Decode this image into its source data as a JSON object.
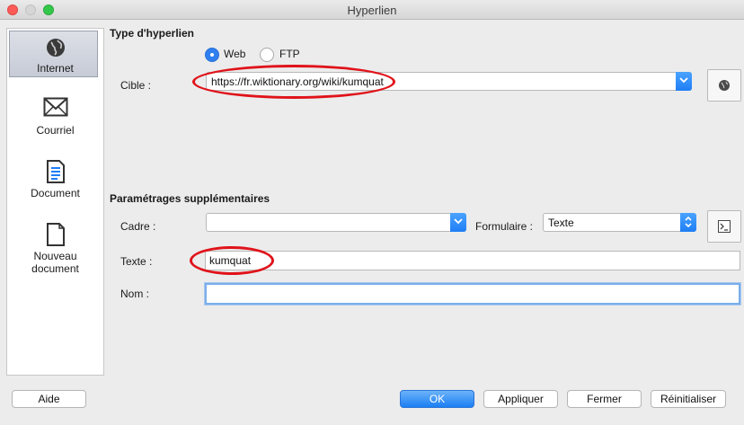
{
  "window": {
    "title": "Hyperlien"
  },
  "sidebar": {
    "items": [
      {
        "label": "Internet",
        "icon": "globe-icon"
      },
      {
        "label": "Courriel",
        "icon": "envelope-icon"
      },
      {
        "label": "Document",
        "icon": "document-icon"
      },
      {
        "label": "Nouveau document",
        "icon": "new-document-icon"
      }
    ],
    "selected": "Internet"
  },
  "hyperlink_type": {
    "title": "Type d'hyperlien",
    "options": [
      "Web",
      "FTP"
    ],
    "selected": "Web"
  },
  "target": {
    "label": "Cible :",
    "value": "https://fr.wiktionary.org/wiki/kumquat"
  },
  "more_settings": {
    "title": "Paramétrages supplémentaires",
    "frame_label": "Cadre :",
    "frame_value": "",
    "form_label": "Formulaire :",
    "form_value": "Texte",
    "text_label": "Texte :",
    "text_value": "kumquat",
    "name_label": "Nom :",
    "name_value": ""
  },
  "buttons": {
    "help": "Aide",
    "ok": "OK",
    "apply": "Appliquer",
    "close": "Fermer",
    "reset": "Réinitialiser"
  },
  "colors": {
    "accent": "#1f7ef5",
    "annotation": "#e0131a"
  }
}
